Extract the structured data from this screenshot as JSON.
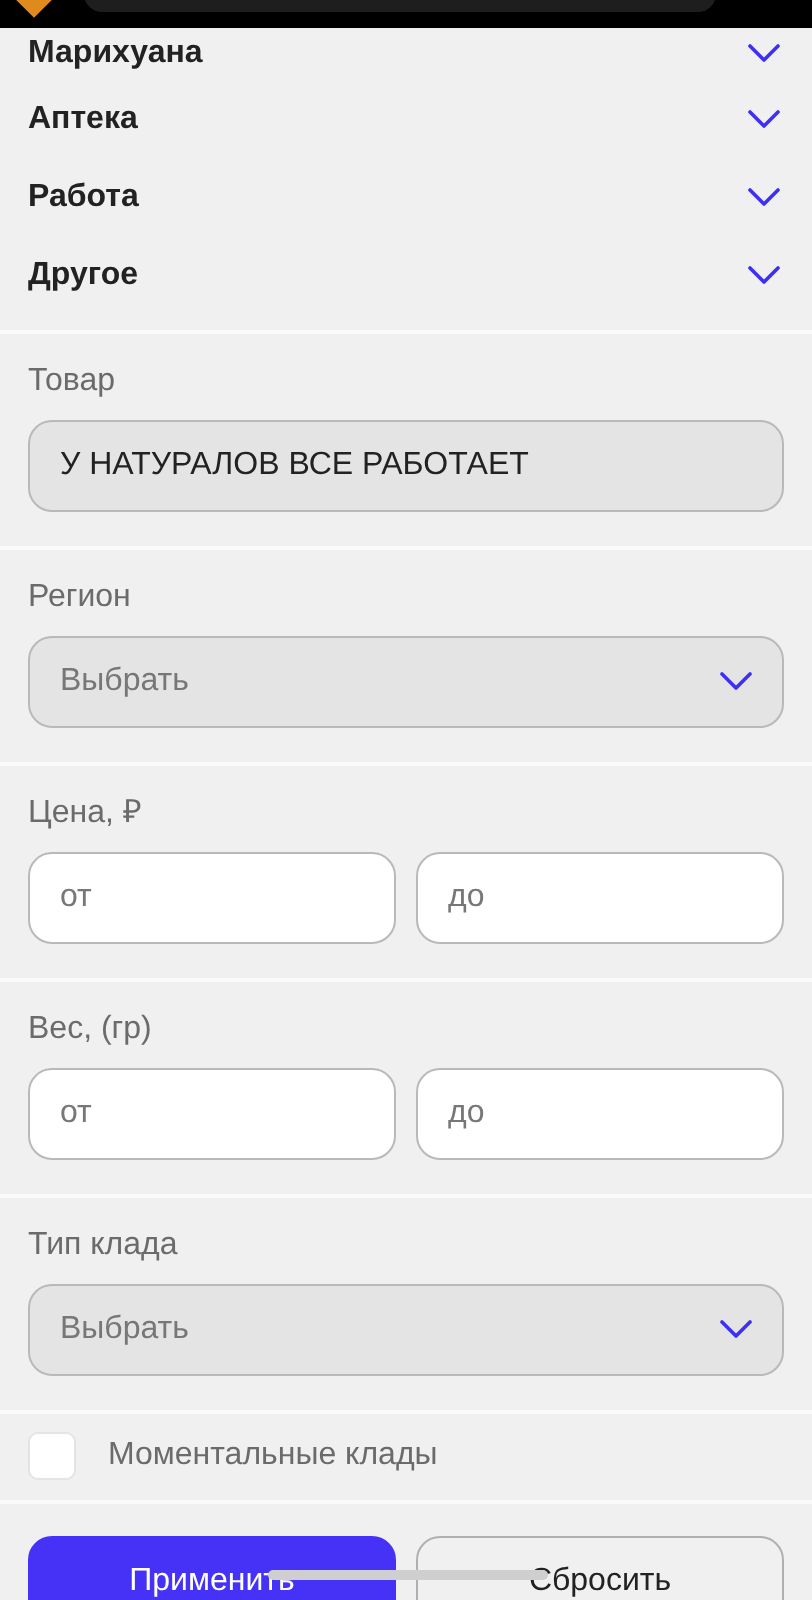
{
  "categories": [
    {
      "label": "Марихуана",
      "expanded": false
    },
    {
      "label": "Аптека",
      "expanded": false
    },
    {
      "label": "Работа",
      "expanded": false
    },
    {
      "label": "Другое",
      "expanded": false
    }
  ],
  "sections": [
    {
      "kind": "text",
      "label": "Товар",
      "value": "У НАТУРАЛОВ ВСЕ РАБОТАЕТ"
    },
    {
      "kind": "select",
      "label": "Регион",
      "placeholder": "Выбрать"
    },
    {
      "kind": "range",
      "label": "Цена, ₽",
      "from_placeholder": "от",
      "to_placeholder": "до"
    },
    {
      "kind": "range",
      "label": "Вес, (гр)",
      "from_placeholder": "от",
      "to_placeholder": "до"
    },
    {
      "kind": "select",
      "label": "Тип клада",
      "placeholder": "Выбрать"
    }
  ],
  "instant": {
    "label": "Моментальные клады",
    "checked": false
  },
  "buttons": [
    {
      "label": "Применить",
      "kind": "primary"
    },
    {
      "label": "Сбросить",
      "kind": "secondary"
    }
  ]
}
